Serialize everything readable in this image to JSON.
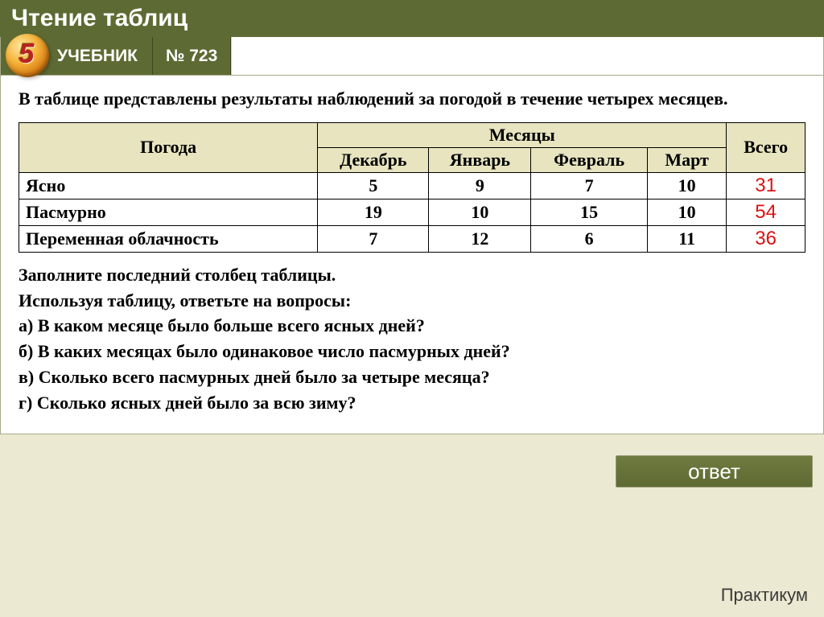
{
  "header": {
    "title": "Чтение таблиц"
  },
  "tabs": {
    "textbook": "УЧЕБНИК",
    "exercise_no": "№ 723",
    "grade": "5"
  },
  "intro": "В таблице представлены результаты наблюдений за погодой в течение четырех месяцев.",
  "table": {
    "weather_label": "Погода",
    "months_label": "Месяцы",
    "total_label": "Всего",
    "months": [
      "Декабрь",
      "Январь",
      "Февраль",
      "Март"
    ],
    "rows": [
      {
        "label": "Ясно",
        "values": [
          5,
          9,
          7,
          10
        ],
        "total": 31
      },
      {
        "label": "Пасмурно",
        "values": [
          19,
          10,
          15,
          10
        ],
        "total": 54
      },
      {
        "label": "Переменная облачность",
        "values": [
          7,
          12,
          6,
          11
        ],
        "total": 36
      }
    ]
  },
  "instructions": {
    "line1": "Заполните последний столбец таблицы.",
    "line2": "Используя таблицу, ответьте на вопросы:",
    "qa": "а) В каком месяце было больше всего ясных дней?",
    "qb": "б) В каких месяцах было одинаковое число пасмурных дней?",
    "qc": "в) Сколько всего пасмурных дней было за четыре месяца?",
    "qd": "г) Сколько ясных дней было за всю зиму?"
  },
  "buttons": {
    "answer": "ответ"
  },
  "footer": {
    "label": "Практикум"
  },
  "chart_data": {
    "type": "table",
    "title": "Результаты наблюдений за погодой",
    "columns": [
      "Погода",
      "Декабрь",
      "Январь",
      "Февраль",
      "Март",
      "Всего"
    ],
    "rows": [
      [
        "Ясно",
        5,
        9,
        7,
        10,
        31
      ],
      [
        "Пасмурно",
        19,
        10,
        15,
        10,
        54
      ],
      [
        "Переменная облачность",
        7,
        12,
        6,
        11,
        36
      ]
    ]
  }
}
